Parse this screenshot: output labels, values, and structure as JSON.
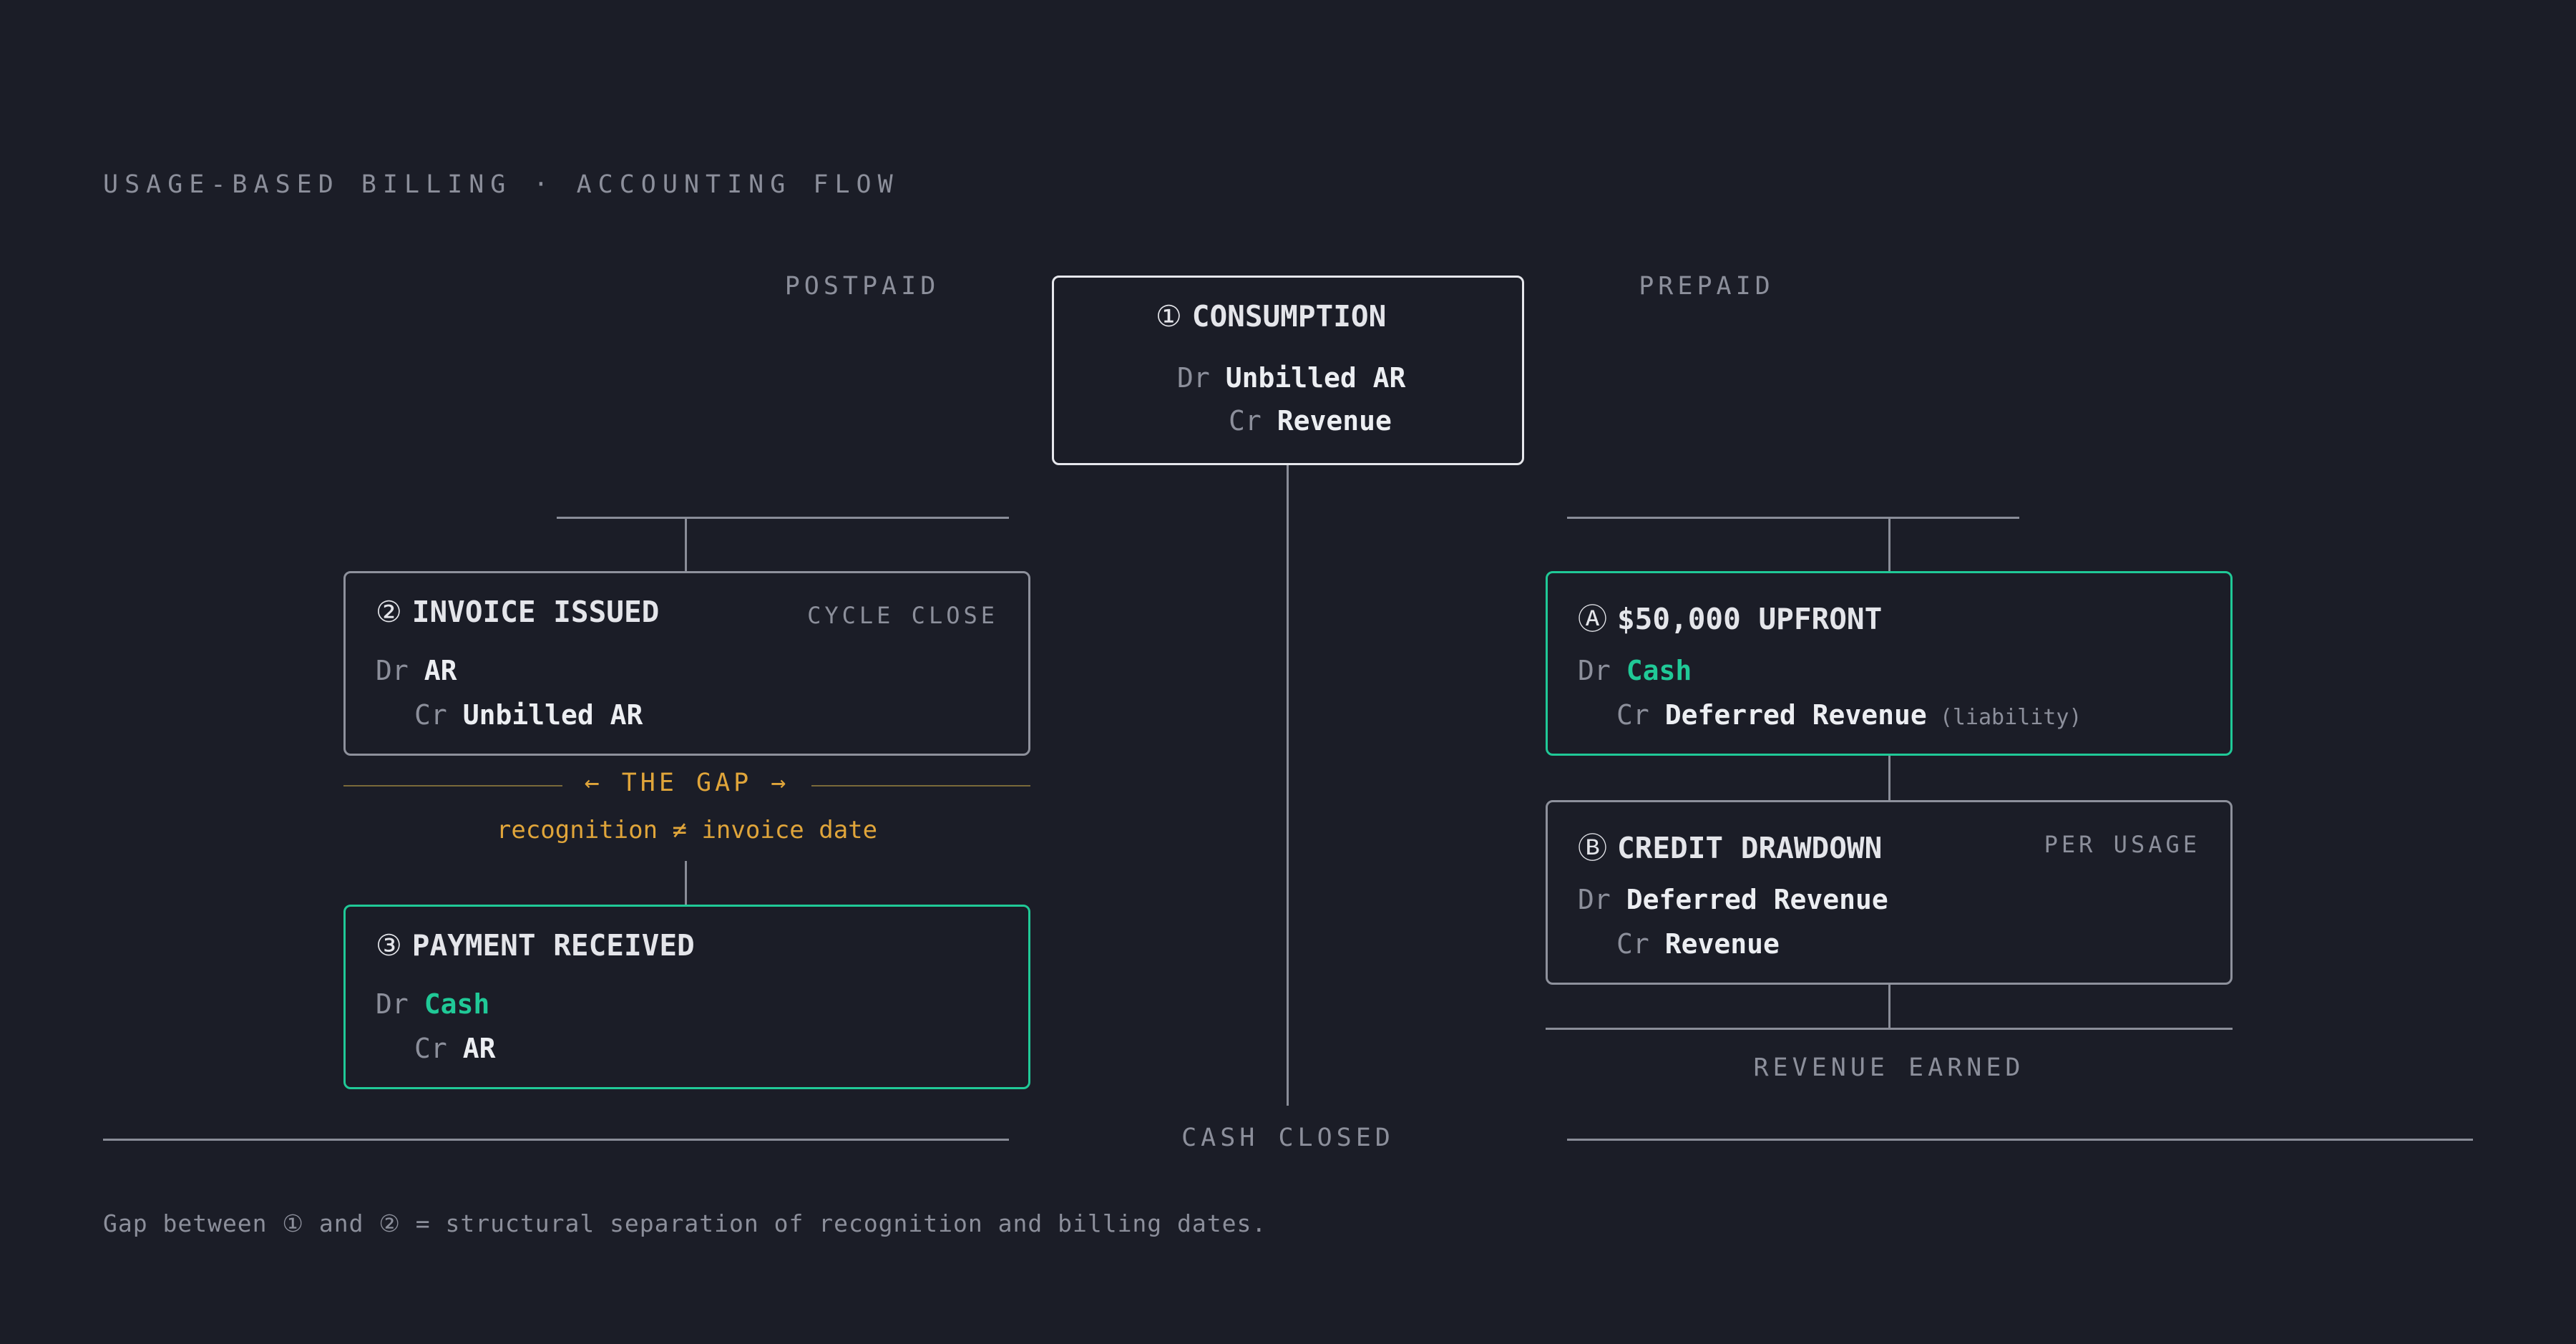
{
  "header": {
    "title": "USAGE-BASED BILLING · ACCOUNTING FLOW"
  },
  "columns": {
    "postpaid": "POSTPAID",
    "prepaid": "PREPAID"
  },
  "consumption": {
    "marker": "①",
    "title": "CONSUMPTION",
    "debit_label": "Dr",
    "debit_account": "Unbilled AR",
    "credit_label": "Cr",
    "credit_account": "Revenue"
  },
  "invoice": {
    "marker": "②",
    "title": "INVOICE ISSUED",
    "tag": "CYCLE CLOSE",
    "debit_label": "Dr",
    "debit_account": "AR",
    "credit_label": "Cr",
    "credit_account": "Unbilled AR"
  },
  "gap": {
    "label": "← THE GAP →",
    "subtitle": "recognition ≠ invoice date"
  },
  "payment": {
    "marker": "③",
    "title": "PAYMENT RECEIVED",
    "debit_label": "Dr",
    "debit_account": "Cash",
    "credit_label": "Cr",
    "credit_account": "AR"
  },
  "upfront": {
    "marker": "Ⓐ",
    "title": "$50,000 UPFRONT",
    "debit_label": "Dr",
    "debit_account": "Cash",
    "credit_label": "Cr",
    "credit_account": "Deferred Revenue",
    "credit_note": "(liability)"
  },
  "drawdown": {
    "marker": "Ⓑ",
    "title": "CREDIT DRAWDOWN",
    "tag": "PER USAGE",
    "debit_label": "Dr",
    "debit_account": "Deferred Revenue",
    "credit_label": "Cr",
    "credit_account": "Revenue"
  },
  "revenue_earned": "REVENUE EARNED",
  "cash_closed": "CASH CLOSED",
  "footer": "Gap between ① and ② = structural separation of recognition and billing dates.",
  "colors": {
    "background": "#1b1d27",
    "accent_green": "#20c997",
    "gap_amber": "#e0a53a",
    "muted": "#8c8f9b"
  }
}
